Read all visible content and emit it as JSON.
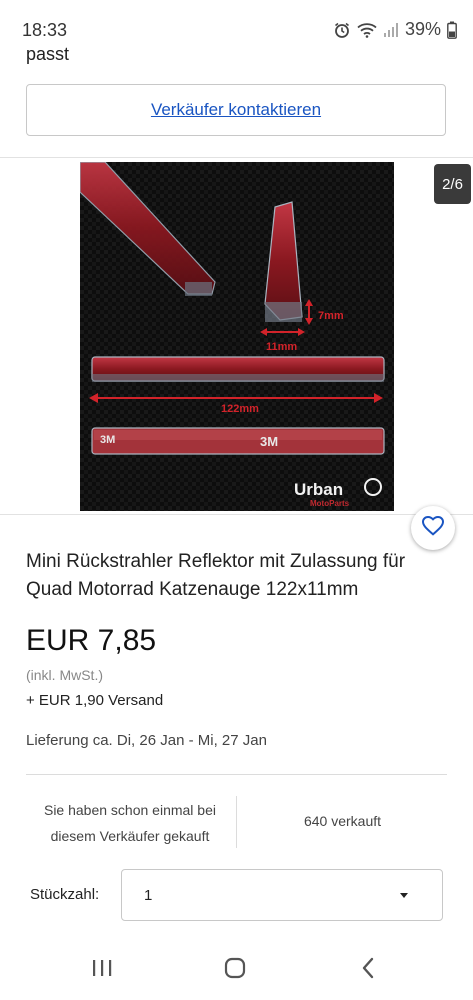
{
  "status_bar": {
    "time": "18:33",
    "battery": "39%",
    "icons": [
      "alarm-icon",
      "wifi-icon",
      "signal-icon",
      "battery-icon"
    ]
  },
  "prev_text": "passt",
  "contact_seller": {
    "label": "Verkäufer kontaktieren"
  },
  "gallery": {
    "counter": "2/6",
    "image_annotations": {
      "height": "7mm",
      "width": "11mm",
      "length": "122mm",
      "tape_brand": "3M",
      "brand_logo": "Urban",
      "brand_sub": "MotoParts"
    }
  },
  "product": {
    "title": "Mini Rückstrahler Reflektor mit Zulassung für Quad Motorrad Katzenauge 122x11mm",
    "price": "EUR 7,85",
    "tax_note": "(inkl. MwSt.)",
    "shipping": "+ EUR 1,90 Versand",
    "delivery": "Lieferung ca. Di, 26 Jan - Mi, 27 Jan"
  },
  "stats": {
    "purchased_before": "Sie haben schon einmal bei diesem Verkäufer gekauft",
    "sold": "640 verkauft"
  },
  "quantity": {
    "label": "Stückzahl:",
    "value": "1"
  },
  "colors": {
    "link": "#1a55c2",
    "reflector_red": "#b3212b",
    "counter_bg": "#3a3a3a"
  },
  "nav": {
    "icons": [
      "recent-apps-icon",
      "home-icon",
      "back-icon"
    ]
  }
}
